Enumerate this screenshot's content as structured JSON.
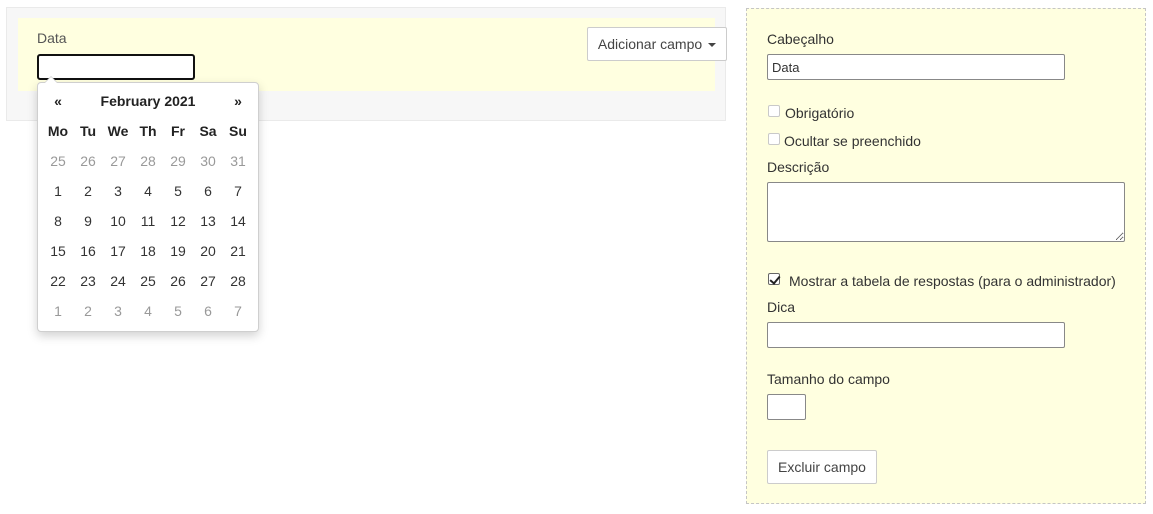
{
  "form_preview": {
    "field_label": "Data",
    "field_value": "",
    "add_field_button": "Adicionar campo"
  },
  "datepicker": {
    "prev": "«",
    "next": "»",
    "title": "February 2021",
    "weekdays": [
      "Mo",
      "Tu",
      "We",
      "Th",
      "Fr",
      "Sa",
      "Su"
    ],
    "weeks": [
      [
        "25",
        "26",
        "27",
        "28",
        "29",
        "30",
        "31"
      ],
      [
        "1",
        "2",
        "3",
        "4",
        "5",
        "6",
        "7"
      ],
      [
        "8",
        "9",
        "10",
        "11",
        "12",
        "13",
        "14"
      ],
      [
        "15",
        "16",
        "17",
        "18",
        "19",
        "20",
        "21"
      ],
      [
        "22",
        "23",
        "24",
        "25",
        "26",
        "27",
        "28"
      ],
      [
        "1",
        "2",
        "3",
        "4",
        "5",
        "6",
        "7"
      ]
    ],
    "muted_weeks": [
      true,
      false,
      false,
      false,
      false,
      true
    ]
  },
  "settings": {
    "header_label": "Cabeçalho",
    "header_value": "Data",
    "required_label": "Obrigatório",
    "required_checked": false,
    "hide_if_filled_label": "Ocultar se preenchido",
    "hide_if_filled_checked": false,
    "description_label": "Descrição",
    "description_value": "",
    "show_table_label": "Mostrar a tabela de respostas (para o administrador)",
    "show_table_checked": true,
    "hint_label": "Dica",
    "hint_value": "",
    "field_size_label": "Tamanho do campo",
    "field_size_value": "",
    "delete_button": "Excluir campo"
  }
}
